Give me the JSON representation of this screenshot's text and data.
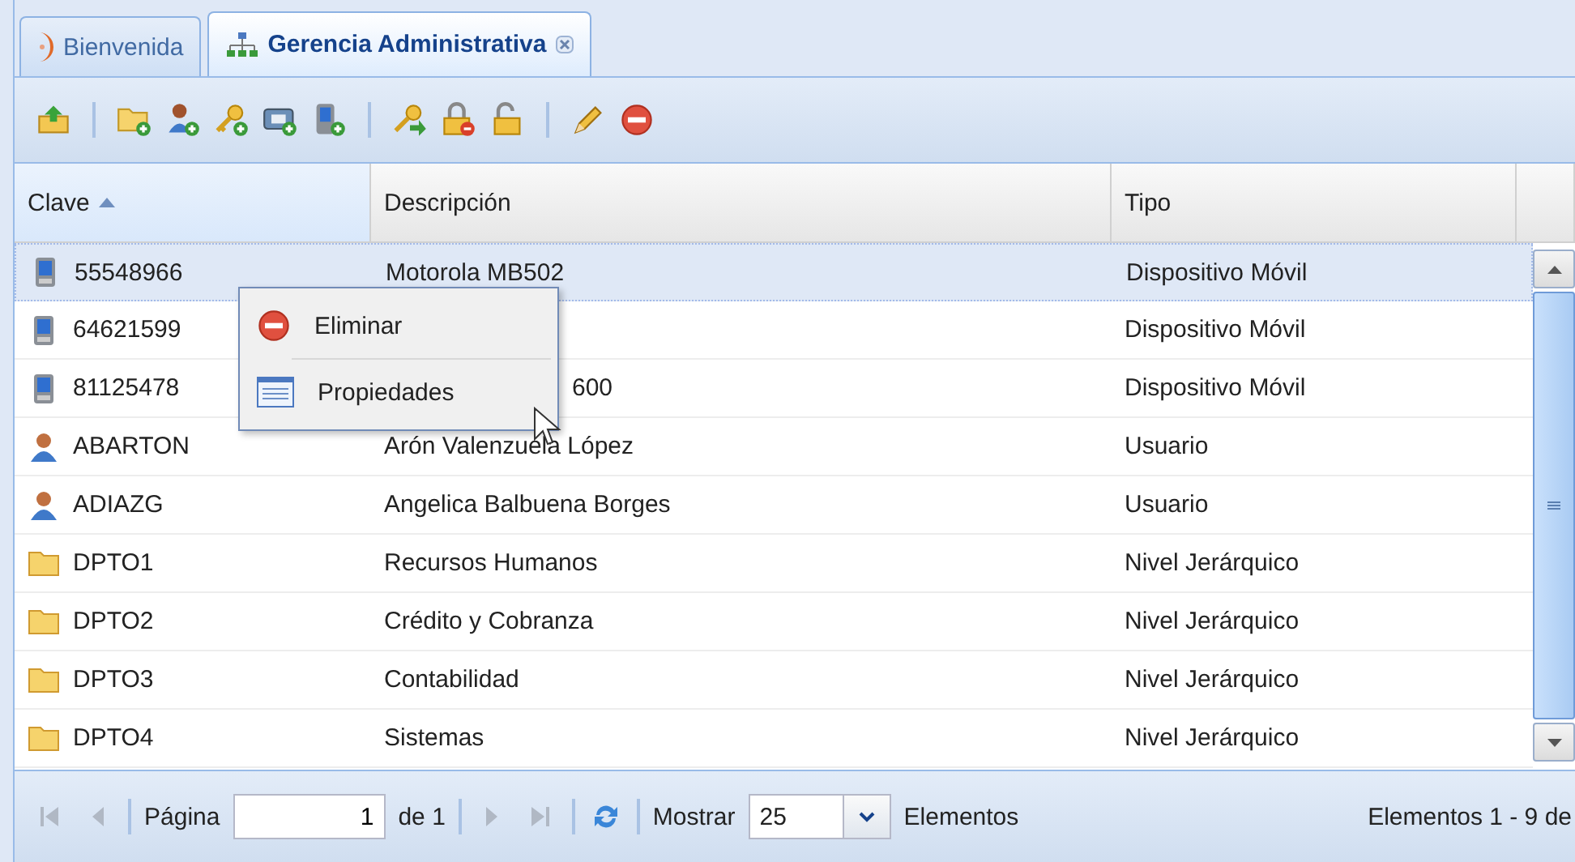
{
  "tabs": [
    {
      "label": "Bienvenida",
      "kind": "home",
      "selected": false,
      "closable": false
    },
    {
      "label": "Gerencia Administrativa",
      "kind": "org",
      "selected": true,
      "closable": true
    }
  ],
  "table": {
    "columns": [
      {
        "label": "Clave",
        "sorted": true
      },
      {
        "label": "Descripción",
        "sorted": false
      },
      {
        "label": "Tipo",
        "sorted": false
      }
    ],
    "rows": [
      {
        "kind": "device",
        "clave": "55548966",
        "descripcion": "Motorola MB502",
        "tipo": "Dispositivo Móvil",
        "selected": true
      },
      {
        "kind": "device",
        "clave": "64621599",
        "tipo": "Dispositivo Móvil",
        "selected": false
      },
      {
        "kind": "device",
        "clave": "81125478",
        "descripcion": "600",
        "tipo": "Dispositivo Móvil",
        "selected": false,
        "covered": true
      },
      {
        "kind": "user",
        "clave": "ABARTON",
        "descripcion": "Arón Valenzuela López",
        "tipo": "Usuario",
        "selected": false
      },
      {
        "kind": "user",
        "clave": "ADIAZG",
        "descripcion": "Angelica Balbuena Borges",
        "tipo": "Usuario",
        "selected": false
      },
      {
        "kind": "folder",
        "clave": "DPTO1",
        "descripcion": "Recursos Humanos",
        "tipo": "Nivel Jerárquico",
        "selected": false
      },
      {
        "kind": "folder",
        "clave": "DPTO2",
        "descripcion": "Crédito y Cobranza",
        "tipo": "Nivel Jerárquico",
        "selected": false
      },
      {
        "kind": "folder",
        "clave": "DPTO3",
        "descripcion": "Contabilidad",
        "tipo": "Nivel Jerárquico",
        "selected": false
      },
      {
        "kind": "folder",
        "clave": "DPTO4",
        "descripcion": "Sistemas",
        "tipo": "Nivel Jerárquico",
        "selected": false
      }
    ]
  },
  "context_menu": [
    {
      "label": "Eliminar",
      "kind": "delete"
    },
    {
      "label": "Propiedades",
      "kind": "properties"
    }
  ],
  "pager": {
    "nav_disabled": true,
    "page_label": "Página",
    "page": "1",
    "of": "de 1",
    "show_label": "Mostrar",
    "page_size": "25",
    "items_label": "Elementos",
    "summary": "Elementos 1 - 9 de"
  }
}
